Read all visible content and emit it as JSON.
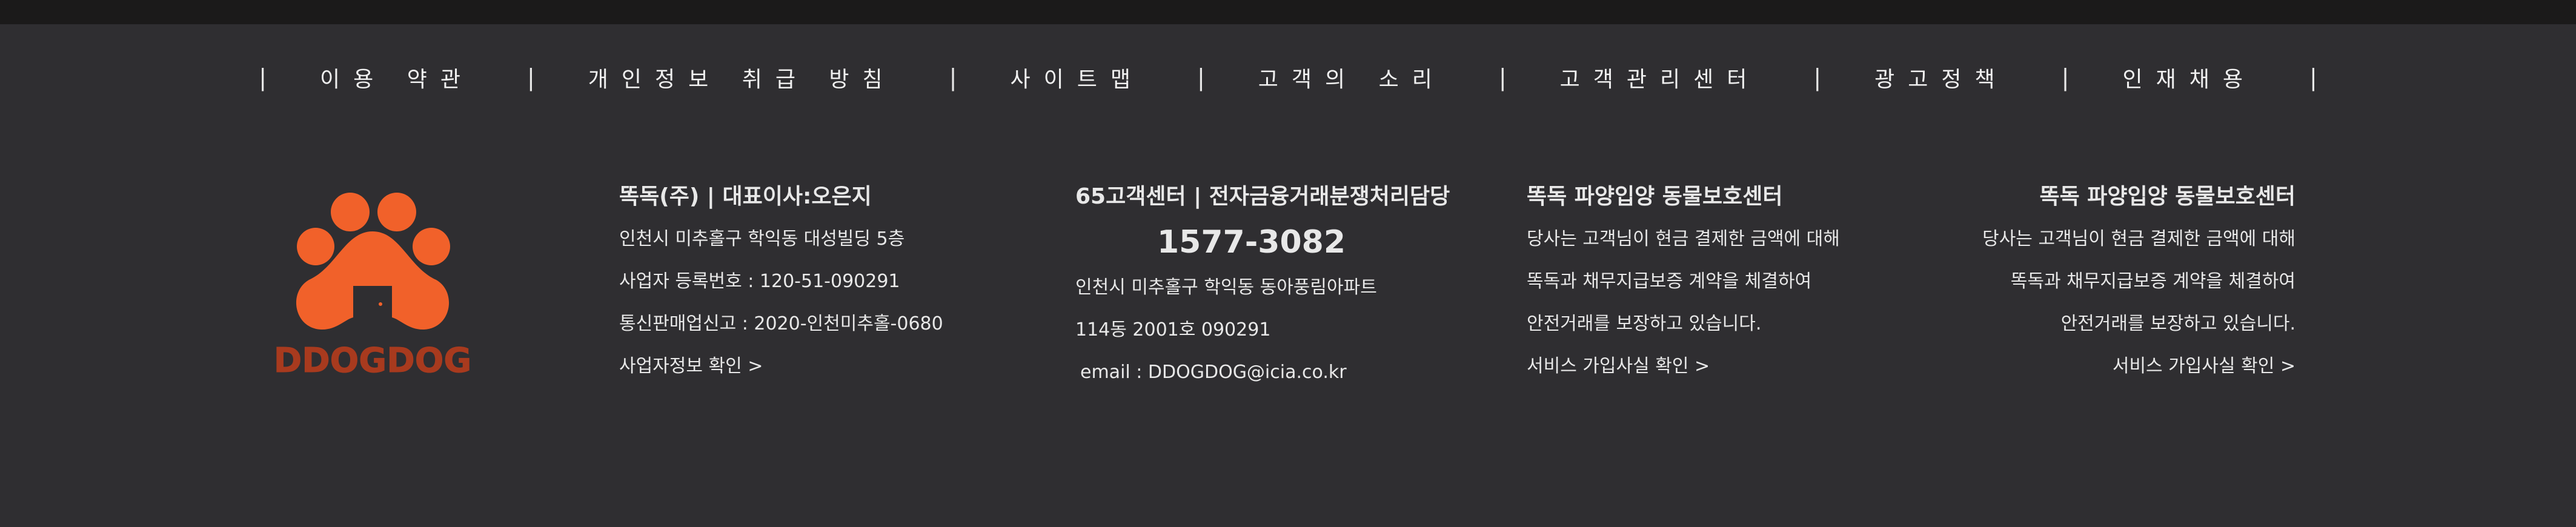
{
  "nav": {
    "separator": "|",
    "links": [
      "이용 약관",
      "개인정보 취급 방침",
      "사이트맵",
      "고객의 소리",
      "고객관리센터",
      "광고정책",
      "인재채용"
    ]
  },
  "logo": {
    "text": "DDOGDOG",
    "color": "#f1612a",
    "text_color": "#a83a1e"
  },
  "company": {
    "title": "똑독(주) | 대표이사:오은지",
    "address": "인천시 미추홀구 학익동 대성빌딩 5층",
    "business_number": "사업자 등록번호 : 120-51-090291",
    "mail_order": "통신판매업신고 : 2020-인천미추홀-0680",
    "business_info_link": "사업자정보 확인 >"
  },
  "customer_center": {
    "title": "65고객센터 | 전자금융거래분쟁처리담당",
    "phone": "1577-3082",
    "address_line1": "인천시 미추홀구 학익동 동아풍림아파트",
    "address_line2": "114동 2001호 090291",
    "email": "email : DDOGDOG@icia.co.kr"
  },
  "protection_left": {
    "title": "똑독 파양입양 동물보호센터",
    "line1": "당사는 고객님이 현금 결제한 금액에 대해",
    "line2": "똑독과 채무지급보증 계약을 체결하여",
    "line3": "안전거래를 보장하고 있습니다.",
    "link": "서비스 가입사실 확인 >"
  },
  "protection_right": {
    "title": "똑독 파양입양 동물보호센터",
    "line1": "당사는 고객님이 현금 결제한 금액에 대해",
    "line2": "똑독과 채무지급보증 계약을 체결하여",
    "line3": "안전거래를 보장하고 있습니다.",
    "link": "서비스 가입사실 확인 >"
  }
}
